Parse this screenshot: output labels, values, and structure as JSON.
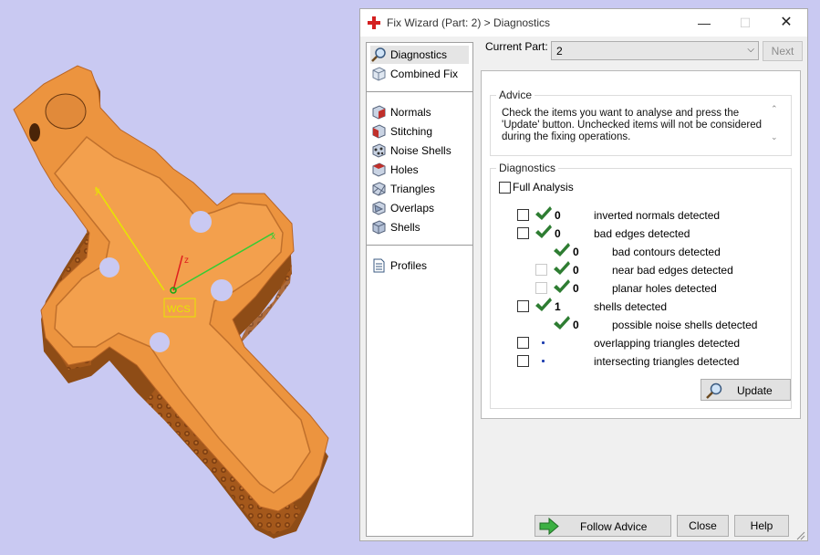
{
  "viewport": {
    "wcs_label": "WCS",
    "axis_x": "x",
    "axis_y": "y",
    "axis_z": "z"
  },
  "window": {
    "title": "Fix Wizard (Part: 2) > Diagnostics",
    "controls": {
      "minimize": "—",
      "maximize": "☐",
      "close": "✕"
    }
  },
  "nav": {
    "items": [
      {
        "label": "Diagnostics",
        "icon": "magnifier-icon",
        "selected": true
      },
      {
        "label": "Combined Fix",
        "icon": "cube-icon"
      },
      {
        "label": "Normals",
        "icon": "normals-cube-icon"
      },
      {
        "label": "Stitching",
        "icon": "stitching-cube-icon"
      },
      {
        "label": "Noise Shells",
        "icon": "noise-shells-icon"
      },
      {
        "label": "Holes",
        "icon": "holes-cube-icon"
      },
      {
        "label": "Triangles",
        "icon": "triangles-cube-icon"
      },
      {
        "label": "Overlaps",
        "icon": "overlaps-cube-icon"
      },
      {
        "label": "Shells",
        "icon": "shells-cube-icon"
      },
      {
        "label": "Profiles",
        "icon": "document-icon"
      }
    ]
  },
  "top": {
    "current_part_label": "Current Part:",
    "current_part_value": "2",
    "next_label": "Next"
  },
  "advice": {
    "title": "Advice",
    "line1": "Check the items you want to analyse and press the",
    "line2": "'Update' button. Unchecked items will not be considered",
    "line3": "during the fixing operations."
  },
  "diagnostics": {
    "title": "Diagnostics",
    "full_analysis_label": "Full Analysis",
    "rows": [
      {
        "label": "inverted normals detected",
        "value": "0",
        "status": "ok",
        "level": 0,
        "checkbox": "enabled"
      },
      {
        "label": "bad edges detected",
        "value": "0",
        "status": "ok",
        "level": 0,
        "checkbox": "enabled"
      },
      {
        "label": "bad contours detected",
        "value": "0",
        "status": "ok",
        "level": 1,
        "checkbox": "none"
      },
      {
        "label": "near bad edges detected",
        "value": "0",
        "status": "ok",
        "level": 1,
        "checkbox": "disabled"
      },
      {
        "label": "planar holes detected",
        "value": "0",
        "status": "ok",
        "level": 1,
        "checkbox": "disabled"
      },
      {
        "label": "shells detected",
        "value": "1",
        "status": "ok",
        "level": 0,
        "checkbox": "enabled"
      },
      {
        "label": "possible noise shells detected",
        "value": "0",
        "status": "ok",
        "level": 1,
        "checkbox": "none"
      },
      {
        "label": "overlapping triangles detected",
        "value": "",
        "status": "pending",
        "level": 0,
        "checkbox": "enabled"
      },
      {
        "label": "intersecting triangles detected",
        "value": "",
        "status": "pending",
        "level": 0,
        "checkbox": "enabled"
      }
    ],
    "update_label": "Update"
  },
  "bottom": {
    "follow_advice_label": "Follow Advice",
    "close_label": "Close",
    "help_label": "Help"
  },
  "colors": {
    "check_green": "#2e7d32",
    "model_orange": "#e58a35",
    "background": "#c9c9f2"
  }
}
